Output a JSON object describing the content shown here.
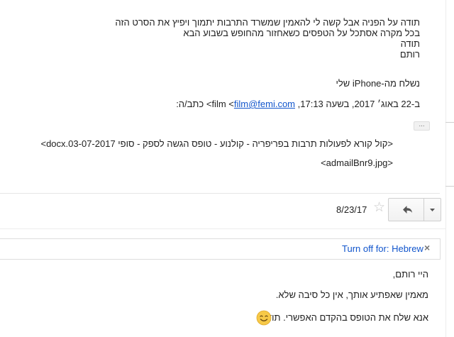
{
  "thread": {
    "quoted_message": {
      "lines": [
        "תודה על הפניה אבל קשה לי להאמין שמשרד התרבות יתמוך ויפיץ את הסרט הזה",
        "בכל מקרה אסתכל על הטפסים כשאחזור מהחופש בשבוע הבא",
        "תודה",
        "רותם"
      ],
      "signature": "נשלח מה-iPhone שלי",
      "attribution_prefix": "ב-22 באוג׳ 2017, בשעה 17:13, film <",
      "attribution_email": "film@femi.com",
      "attribution_suffix": "> כתב/ה:",
      "show_trimmed_label": "...",
      "attachments": [
        "<קול קורא לפעולות תרבות בפריפריה - קולנוע - טופס הגשה לספק - סופי 03-07-2017.docx>",
        "<admailBnr9.jpg>"
      ]
    },
    "message_header": {
      "date": "8/23/17",
      "star_icon": "star-outline-icon",
      "reply_icon": "reply-arrow-icon",
      "more_icon": "dropdown-arrow-icon"
    },
    "translate_bar": {
      "label": "Turn off for: Hebrew",
      "close_label": "×"
    },
    "message_body": {
      "greeting": "היי רותם,",
      "line1": "מאמין שאפתיע אותך, אין כל סיבה שלא.",
      "line2": "אנא שלח את הטופס בהקדם האפשרי. תודה",
      "emoji": "smiling-face-emoji"
    }
  },
  "colors": {
    "link": "#1155cc",
    "text": "#222222",
    "border": "#dddddd",
    "star": "#c6c6c6",
    "emoji_face": "#f7c948"
  }
}
